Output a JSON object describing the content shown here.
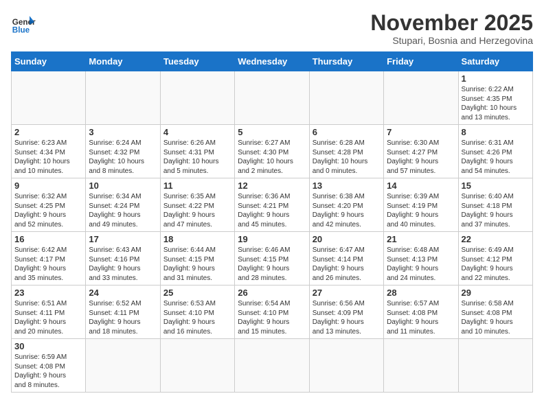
{
  "logo": {
    "general": "General",
    "blue": "Blue"
  },
  "header": {
    "month_year": "November 2025",
    "location": "Stupari, Bosnia and Herzegovina"
  },
  "weekdays": [
    "Sunday",
    "Monday",
    "Tuesday",
    "Wednesday",
    "Thursday",
    "Friday",
    "Saturday"
  ],
  "weeks": [
    [
      {
        "day": "",
        "info": ""
      },
      {
        "day": "",
        "info": ""
      },
      {
        "day": "",
        "info": ""
      },
      {
        "day": "",
        "info": ""
      },
      {
        "day": "",
        "info": ""
      },
      {
        "day": "",
        "info": ""
      },
      {
        "day": "1",
        "info": "Sunrise: 6:22 AM\nSunset: 4:35 PM\nDaylight: 10 hours\nand 13 minutes."
      }
    ],
    [
      {
        "day": "2",
        "info": "Sunrise: 6:23 AM\nSunset: 4:34 PM\nDaylight: 10 hours\nand 10 minutes."
      },
      {
        "day": "3",
        "info": "Sunrise: 6:24 AM\nSunset: 4:32 PM\nDaylight: 10 hours\nand 8 minutes."
      },
      {
        "day": "4",
        "info": "Sunrise: 6:26 AM\nSunset: 4:31 PM\nDaylight: 10 hours\nand 5 minutes."
      },
      {
        "day": "5",
        "info": "Sunrise: 6:27 AM\nSunset: 4:30 PM\nDaylight: 10 hours\nand 2 minutes."
      },
      {
        "day": "6",
        "info": "Sunrise: 6:28 AM\nSunset: 4:28 PM\nDaylight: 10 hours\nand 0 minutes."
      },
      {
        "day": "7",
        "info": "Sunrise: 6:30 AM\nSunset: 4:27 PM\nDaylight: 9 hours\nand 57 minutes."
      },
      {
        "day": "8",
        "info": "Sunrise: 6:31 AM\nSunset: 4:26 PM\nDaylight: 9 hours\nand 54 minutes."
      }
    ],
    [
      {
        "day": "9",
        "info": "Sunrise: 6:32 AM\nSunset: 4:25 PM\nDaylight: 9 hours\nand 52 minutes."
      },
      {
        "day": "10",
        "info": "Sunrise: 6:34 AM\nSunset: 4:24 PM\nDaylight: 9 hours\nand 49 minutes."
      },
      {
        "day": "11",
        "info": "Sunrise: 6:35 AM\nSunset: 4:22 PM\nDaylight: 9 hours\nand 47 minutes."
      },
      {
        "day": "12",
        "info": "Sunrise: 6:36 AM\nSunset: 4:21 PM\nDaylight: 9 hours\nand 45 minutes."
      },
      {
        "day": "13",
        "info": "Sunrise: 6:38 AM\nSunset: 4:20 PM\nDaylight: 9 hours\nand 42 minutes."
      },
      {
        "day": "14",
        "info": "Sunrise: 6:39 AM\nSunset: 4:19 PM\nDaylight: 9 hours\nand 40 minutes."
      },
      {
        "day": "15",
        "info": "Sunrise: 6:40 AM\nSunset: 4:18 PM\nDaylight: 9 hours\nand 37 minutes."
      }
    ],
    [
      {
        "day": "16",
        "info": "Sunrise: 6:42 AM\nSunset: 4:17 PM\nDaylight: 9 hours\nand 35 minutes."
      },
      {
        "day": "17",
        "info": "Sunrise: 6:43 AM\nSunset: 4:16 PM\nDaylight: 9 hours\nand 33 minutes."
      },
      {
        "day": "18",
        "info": "Sunrise: 6:44 AM\nSunset: 4:15 PM\nDaylight: 9 hours\nand 31 minutes."
      },
      {
        "day": "19",
        "info": "Sunrise: 6:46 AM\nSunset: 4:15 PM\nDaylight: 9 hours\nand 28 minutes."
      },
      {
        "day": "20",
        "info": "Sunrise: 6:47 AM\nSunset: 4:14 PM\nDaylight: 9 hours\nand 26 minutes."
      },
      {
        "day": "21",
        "info": "Sunrise: 6:48 AM\nSunset: 4:13 PM\nDaylight: 9 hours\nand 24 minutes."
      },
      {
        "day": "22",
        "info": "Sunrise: 6:49 AM\nSunset: 4:12 PM\nDaylight: 9 hours\nand 22 minutes."
      }
    ],
    [
      {
        "day": "23",
        "info": "Sunrise: 6:51 AM\nSunset: 4:11 PM\nDaylight: 9 hours\nand 20 minutes."
      },
      {
        "day": "24",
        "info": "Sunrise: 6:52 AM\nSunset: 4:11 PM\nDaylight: 9 hours\nand 18 minutes."
      },
      {
        "day": "25",
        "info": "Sunrise: 6:53 AM\nSunset: 4:10 PM\nDaylight: 9 hours\nand 16 minutes."
      },
      {
        "day": "26",
        "info": "Sunrise: 6:54 AM\nSunset: 4:10 PM\nDaylight: 9 hours\nand 15 minutes."
      },
      {
        "day": "27",
        "info": "Sunrise: 6:56 AM\nSunset: 4:09 PM\nDaylight: 9 hours\nand 13 minutes."
      },
      {
        "day": "28",
        "info": "Sunrise: 6:57 AM\nSunset: 4:08 PM\nDaylight: 9 hours\nand 11 minutes."
      },
      {
        "day": "29",
        "info": "Sunrise: 6:58 AM\nSunset: 4:08 PM\nDaylight: 9 hours\nand 10 minutes."
      }
    ],
    [
      {
        "day": "30",
        "info": "Sunrise: 6:59 AM\nSunset: 4:08 PM\nDaylight: 9 hours\nand 8 minutes."
      },
      {
        "day": "",
        "info": ""
      },
      {
        "day": "",
        "info": ""
      },
      {
        "day": "",
        "info": ""
      },
      {
        "day": "",
        "info": ""
      },
      {
        "day": "",
        "info": ""
      },
      {
        "day": "",
        "info": ""
      }
    ]
  ]
}
